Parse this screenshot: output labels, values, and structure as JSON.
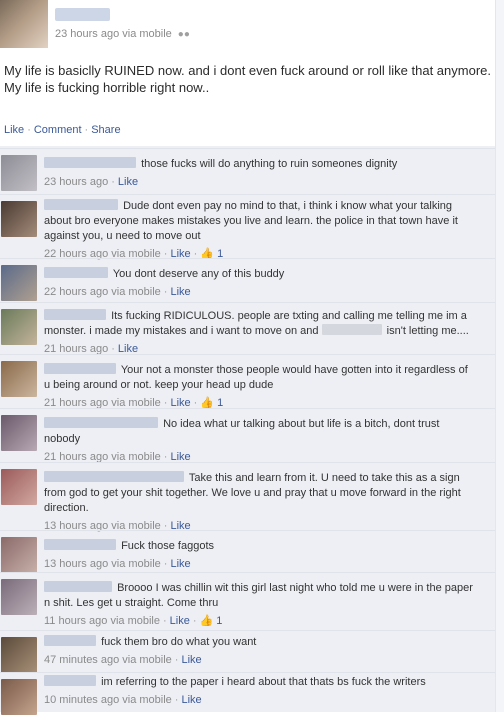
{
  "post": {
    "timestamp": "23 hours ago via mobile",
    "text": "My life is basiclly RUINED now. and i dont even fuck around or roll like that anymore. My life is fucking horrible right now..",
    "actions": {
      "like": "Like",
      "comment": "Comment",
      "share": "Share"
    }
  },
  "comments": [
    {
      "text": "those fucks will do anything to ruin someones dignity",
      "meta": "23 hours ago",
      "like": "Like",
      "likes": ""
    },
    {
      "text": "Dude dont even pay no mind to that, i think i know what your talking about bro everyone makes mistakes you live and learn. the police in that town have it against you, u need to move out",
      "meta": "22 hours ago via mobile",
      "like": "Like",
      "likes": "1"
    },
    {
      "text": "You dont deserve any of this buddy",
      "meta": "22 hours ago via mobile",
      "like": "Like",
      "likes": ""
    },
    {
      "text": "Its fucking RIDICULOUS. people are txting and calling me telling me im a monster. i made my mistakes and i want to move on and",
      "text2": "isn't letting me....",
      "meta": "21 hours ago",
      "like": "Like",
      "likes": ""
    },
    {
      "text": "Your not a monster those people would have gotten into it regardless of u being around or not. keep your head up dude",
      "meta": "21 hours ago via mobile",
      "like": "Like",
      "likes": "1"
    },
    {
      "text": "No idea what ur talking about but life is a bitch, dont trust nobody",
      "meta": "21 hours ago via mobile",
      "like": "Like",
      "likes": ""
    },
    {
      "text": "Take this and learn from it. U need to take this as a sign from god to get your shit together. We love u and pray that u move forward in the right direction.",
      "meta": "13 hours ago via mobile",
      "like": "Like",
      "likes": ""
    },
    {
      "text": "Fuck those faggots",
      "meta": "13 hours ago via mobile",
      "like": "Like",
      "likes": ""
    },
    {
      "text": "Broooo I was chillin wit this girl last night who told me u were in the paper n shit. Les get u straight. Come thru",
      "meta": "11 hours ago via mobile",
      "like": "Like",
      "likes": "1"
    },
    {
      "text": "fuck them bro do what you want",
      "meta": "47 minutes ago via mobile",
      "like": "Like",
      "likes": ""
    },
    {
      "text": "im referring to the paper i heard about that thats bs fuck the writers",
      "meta": "10 minutes ago via mobile",
      "like": "Like",
      "likes": ""
    }
  ],
  "colors": {
    "link": "#3b5998",
    "meta": "#8a8a8a",
    "comment_bg": "#edeff4"
  },
  "icons": {
    "audience": "people-icon",
    "like": "thumbs-up-icon"
  }
}
